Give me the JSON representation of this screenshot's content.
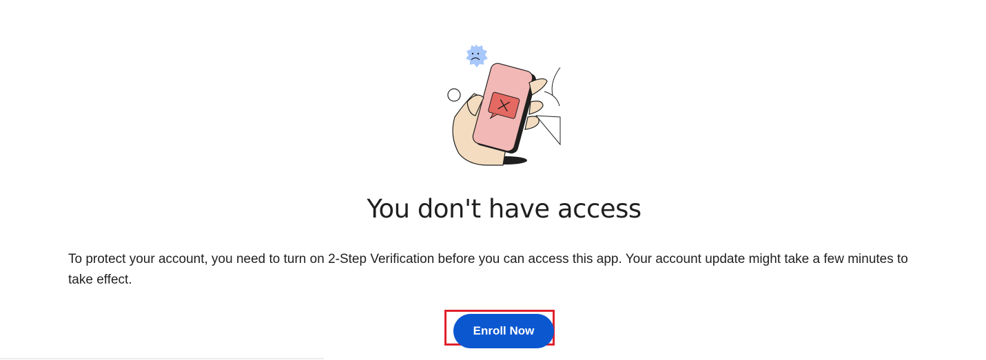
{
  "page": {
    "heading": "You don't have access",
    "message": "To protect your account, you need to turn on 2-Step Verification before you can access this app. Your account update might take a few minutes to take effect.",
    "primary_button_label": "Enroll Now"
  },
  "illustration": {
    "icon": "phone-error-illustration",
    "colors": {
      "phone_screen": "#f2b8b5",
      "error_bubble": "#e46962",
      "sad_badge": "#a8c7fa",
      "skin": "#f3dcc0",
      "outline": "#1f1f1f"
    }
  },
  "colors": {
    "accent": "#0b57d0",
    "highlight_box": "#e0202a",
    "text": "#1f1f1f"
  }
}
